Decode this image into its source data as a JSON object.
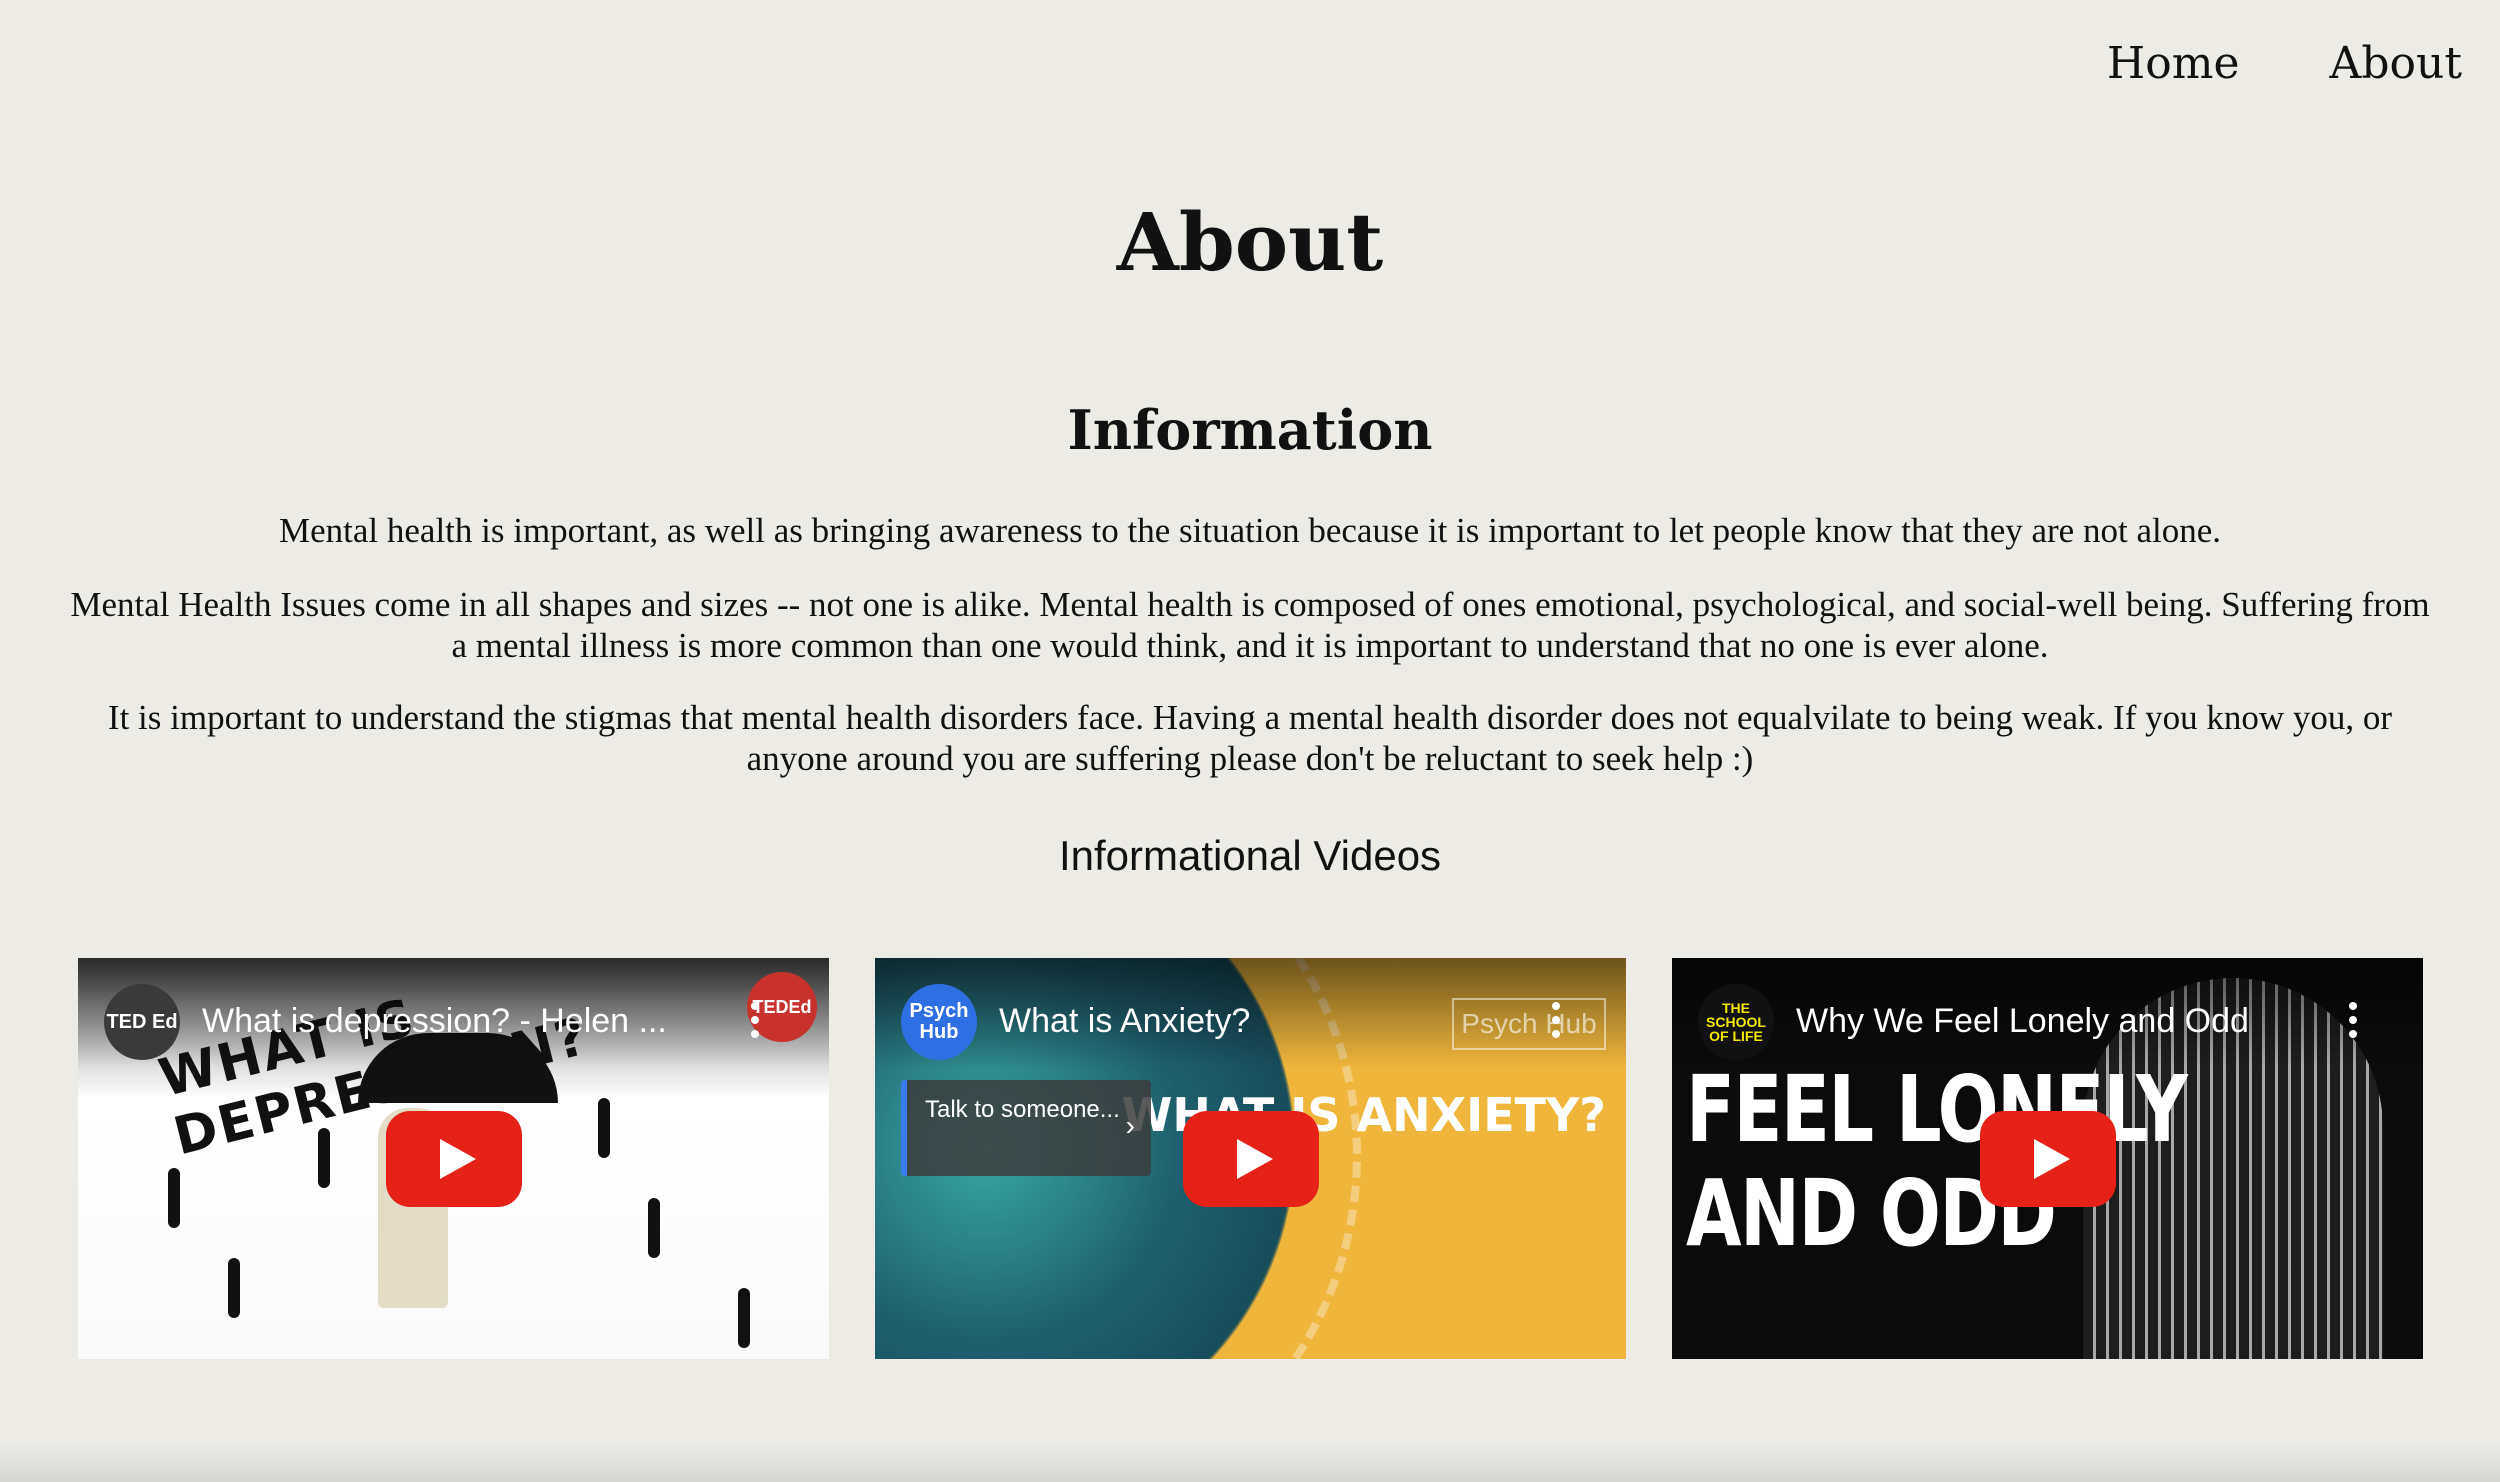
{
  "nav": {
    "home": "Home",
    "about": "About"
  },
  "page": {
    "title": "About"
  },
  "info": {
    "heading": "Information",
    "p1": "Mental health is important, as well as bringing awareness to the situation because it is important to let people know that they are not alone.",
    "p2": "Mental Health Issues come in all shapes and sizes -- not one is alike. Mental health is composed of ones emotional, psychological, and social-well being. Suffering from a mental illness is more common than one would think, and it is important to understand that no one is ever alone.",
    "p3": "It is important to understand the stigmas that mental health disorders face. Having a mental health disorder does not equalvilate to being weak. If you know you, or anyone around you are suffering please don't be reluctant to seek help :)"
  },
  "videos": {
    "heading": "Informational Videos",
    "items": [
      {
        "title": "What is depression? - Helen ...",
        "channel": "TED Ed",
        "badge": "TEDEd",
        "thumb_text": "WHAT IS DEPRESSION?",
        "icon": "play-icon"
      },
      {
        "title": "What is Anxiety?",
        "channel": "Psych Hub",
        "badge": "Psych Hub",
        "thumb_text": "WHAT IS ANXIETY?",
        "card": "Talk to someone...",
        "icon": "play-icon"
      },
      {
        "title": "Why We Feel Lonely and Odd",
        "channel": "THE SCHOOL OF LIFE",
        "thumb_text": "FEEL LONELY AND ODD",
        "icon": "play-icon"
      }
    ]
  },
  "colors": {
    "background": "#ecebe6",
    "play": "#e62117"
  }
}
